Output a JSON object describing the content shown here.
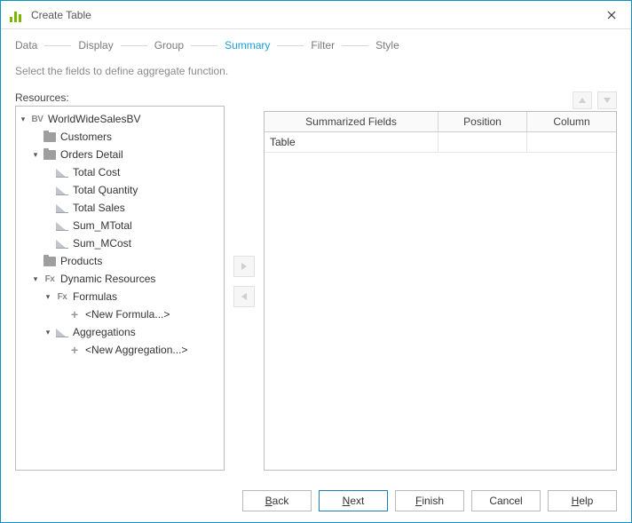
{
  "window": {
    "title": "Create Table"
  },
  "steps": {
    "data": "Data",
    "display": "Display",
    "group": "Group",
    "summary": "Summary",
    "filter": "Filter",
    "style": "Style",
    "active": "summary"
  },
  "description": "Select the fields to define aggregate function.",
  "resources": {
    "label": "Resources:",
    "tree": {
      "root": "WorldWideSalesBV",
      "customers": "Customers",
      "orders_detail": "Orders Detail",
      "total_cost": "Total Cost",
      "total_quantity": "Total Quantity",
      "total_sales": "Total Sales",
      "sum_mtotal": "Sum_MTotal",
      "sum_mcost": "Sum_MCost",
      "products": "Products",
      "dynamic_resources": "Dynamic Resources",
      "formulas": "Formulas",
      "new_formula": "<New Formula...>",
      "aggregations": "Aggregations",
      "new_aggregation": "<New Aggregation...>"
    }
  },
  "grid": {
    "headers": {
      "summarized": "Summarized Fields",
      "position": "Position",
      "column": "Column"
    },
    "rows": [
      {
        "summarized": "Table",
        "position": "",
        "column": ""
      }
    ]
  },
  "buttons": {
    "back": "Back",
    "next": "Next",
    "finish": "Finish",
    "cancel": "Cancel",
    "help": "Help"
  }
}
